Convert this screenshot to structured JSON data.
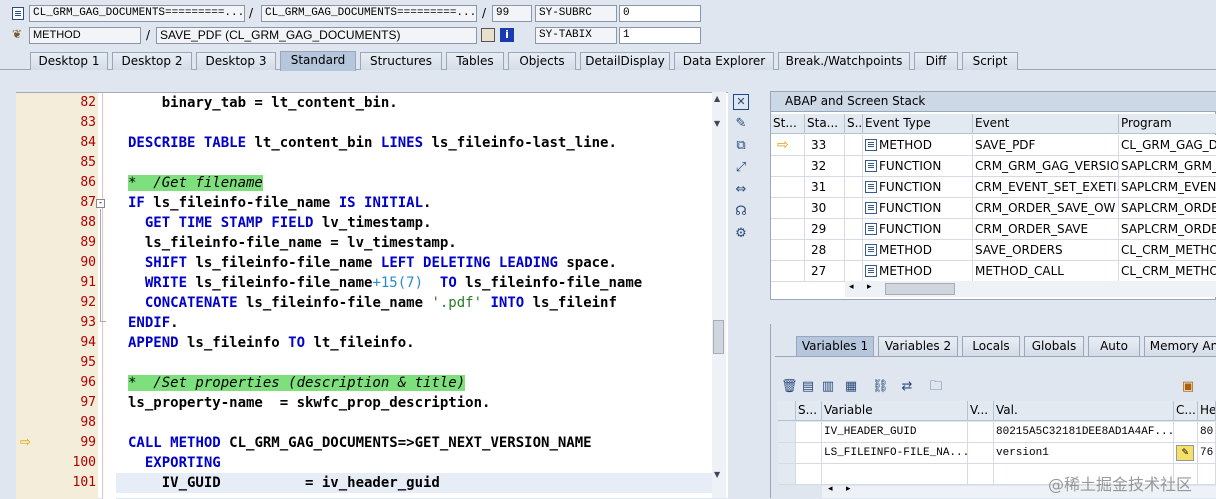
{
  "header": {
    "row1": {
      "program": "CL_GRM_GAG_DOCUMENTS=========...",
      "include": "CL_GRM_GAG_DOCUMENTS=========...",
      "line": "99",
      "sys_field1": "SY-SUBRC",
      "sys_value1": "0"
    },
    "row2": {
      "event_type": "METHOD",
      "event": "SAVE_PDF (CL_GRM_GAG_DOCUMENTS)",
      "sys_field2": "SY-TABIX",
      "sys_value2": "1"
    }
  },
  "tabs": [
    "Desktop 1",
    "Desktop 2",
    "Desktop 3",
    "Standard",
    "Structures",
    "Tables",
    "Objects",
    "DetailDisplay",
    "Data Explorer",
    "Break./Watchpoints",
    "Diff",
    "Script"
  ],
  "active_tab": "Standard",
  "code_lines": [
    {
      "num": "82",
      "text": "    binary_tab = lt_content_bin."
    },
    {
      "num": "83",
      "text": ""
    },
    {
      "num": "84",
      "text": "DESCRIBE TABLE lt_content_bin LINES ls_fileinfo-last_line."
    },
    {
      "num": "85",
      "text": ""
    },
    {
      "num": "86",
      "text": "*  /Get filename"
    },
    {
      "num": "87",
      "text": "IF ls_fileinfo-file_name IS INITIAL."
    },
    {
      "num": "88",
      "text": "  GET TIME STAMP FIELD lv_timestamp."
    },
    {
      "num": "89",
      "text": "  ls_fileinfo-file_name = lv_timestamp."
    },
    {
      "num": "90",
      "text": "  SHIFT ls_fileinfo-file_name LEFT DELETING LEADING space."
    },
    {
      "num": "91",
      "text": "  WRITE ls_fileinfo-file_name+15(7)  TO ls_fileinfo-file_name"
    },
    {
      "num": "92",
      "text": "  CONCATENATE ls_fileinfo-file_name '.pdf' INTO ls_fileinf"
    },
    {
      "num": "93",
      "text": "ENDIF."
    },
    {
      "num": "94",
      "text": "APPEND ls_fileinfo TO lt_fileinfo."
    },
    {
      "num": "95",
      "text": ""
    },
    {
      "num": "96",
      "text": "*  /Set properties (description & title)"
    },
    {
      "num": "97",
      "text": "ls_property-name  = skwfc_prop_description."
    },
    {
      "num": "98",
      "text": ""
    },
    {
      "num": "99",
      "text": "CALL METHOD CL_GRM_GAG_DOCUMENTS=>GET_NEXT_VERSION_NAME"
    },
    {
      "num": "100",
      "text": "  EXPORTING"
    },
    {
      "num": "101",
      "text": "    IV_GUID          = iv_header_guid"
    }
  ],
  "stack": {
    "title": "ABAP and Screen Stack",
    "columns": [
      "St...",
      "Sta...",
      "S...",
      "Event Type",
      "Event",
      "Program"
    ],
    "rows": [
      {
        "level": "33",
        "type": "METHOD",
        "event": "SAVE_PDF",
        "program": "CL_GRM_GAG_DO"
      },
      {
        "level": "32",
        "type": "FUNCTION",
        "event": "CRM_GRM_GAG_VERSIO...",
        "program": "SAPLCRM_GRM_G"
      },
      {
        "level": "31",
        "type": "FUNCTION",
        "event": "CRM_EVENT_SET_EXETI...",
        "program": "SAPLCRM_EVENT_"
      },
      {
        "level": "30",
        "type": "FUNCTION",
        "event": "CRM_ORDER_SAVE_OW",
        "program": "SAPLCRM_ORDER_"
      },
      {
        "level": "29",
        "type": "FUNCTION",
        "event": "CRM_ORDER_SAVE",
        "program": "SAPLCRM_ORDER_"
      },
      {
        "level": "28",
        "type": "METHOD",
        "event": "SAVE_ORDERS",
        "program": "CL_CRM_METHOD"
      },
      {
        "level": "27",
        "type": "METHOD",
        "event": "METHOD_CALL",
        "program": "CL_CRM_METHOD"
      }
    ]
  },
  "var_tabs": [
    "Variables 1",
    "Variables 2",
    "Locals",
    "Globals",
    "Auto",
    "Memory An"
  ],
  "variables": {
    "columns": [
      "S...",
      "Variable",
      "V...",
      "Val.",
      "C...",
      "He"
    ],
    "rows": [
      {
        "name": "IV_HEADER_GUID",
        "value": "80215A5C32181DEE8AD1A4AF...",
        "hex": "80"
      },
      {
        "name": "LS_FILEINFO-FILE_NA...",
        "value": "version1",
        "hex": "76"
      }
    ]
  },
  "watermark": "@稀土掘金技术社区"
}
